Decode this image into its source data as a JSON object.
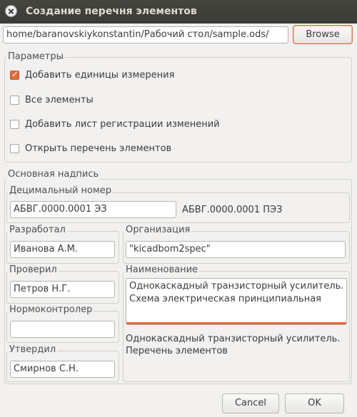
{
  "window": {
    "title": "Создание перечня элементов"
  },
  "file": {
    "path": "/home/baranovskiykonstantin/Рабочий стол/sample.ods",
    "browse_label": "Browse"
  },
  "params": {
    "legend": "Параметры",
    "options": [
      {
        "label": "Добавить единицы измерения",
        "checked": true
      },
      {
        "label": "Все элементы",
        "checked": false
      },
      {
        "label": "Добавить лист регистрации изменений",
        "checked": false
      },
      {
        "label": "Открыть перечень элементов",
        "checked": false
      }
    ]
  },
  "stamp": {
    "legend": "Основная надпись",
    "decimal": {
      "legend": "Децимальный номер",
      "value": "АБВГ.0000.0001 ЭЗ",
      "result": "АБВГ.0000.0001 ПЭЗ"
    },
    "developer": {
      "legend": "Разработал",
      "value": "Иванова А.М."
    },
    "organization": {
      "legend": "Организация",
      "value": "\"kicadbom2spec\""
    },
    "checked": {
      "legend": "Проверил",
      "value": "Петров Н.Г."
    },
    "title": {
      "legend": "Наименование",
      "line1": "Однокаскадный транзисторный усилитель.",
      "line2": "Схема электрическая принципиальная",
      "result1": "Однокаскадный транзисторный усилитель.",
      "result2": "Перечень элементов"
    },
    "normcontrol": {
      "legend": "Нормоконтролер",
      "value": ""
    },
    "approved": {
      "legend": "Утвердил",
      "value": "Смирнов С.Н."
    }
  },
  "buttons": {
    "cancel": "Cancel",
    "ok": "OK"
  },
  "colors": {
    "accent": "#e06a3f",
    "titlebar": "#3b3a35"
  }
}
